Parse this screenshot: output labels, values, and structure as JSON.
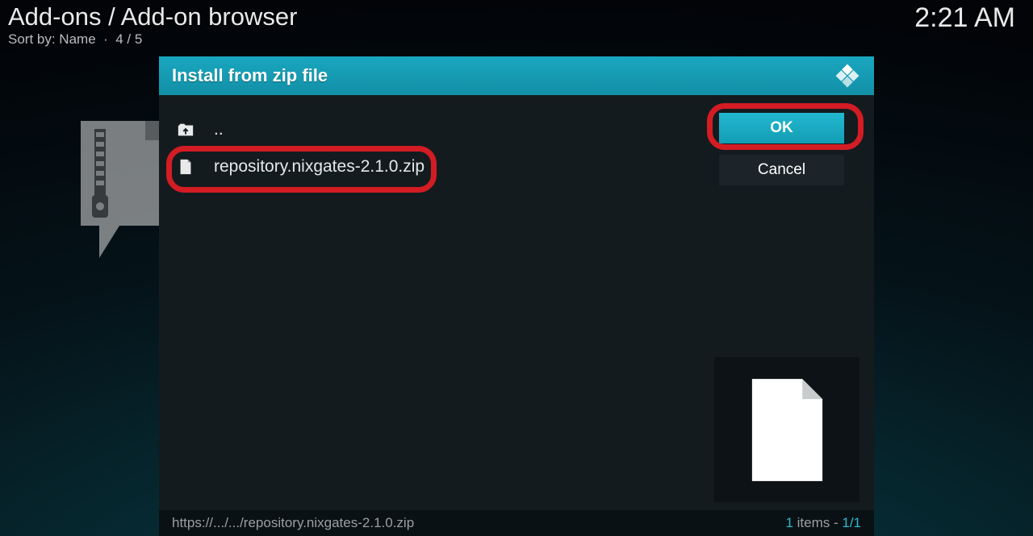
{
  "header": {
    "breadcrumb": "Add-ons / Add-on browser",
    "sort_label": "Sort by: Name",
    "position": "4 / 5"
  },
  "clock": "2:21 AM",
  "dialog": {
    "title": "Install from zip file",
    "parent_label": "..",
    "file_name": "repository.nixgates-2.1.0.zip",
    "ok_label": "OK",
    "cancel_label": "Cancel",
    "footer_path": "https://.../.../repository.nixgates-2.1.0.zip",
    "footer_count_prefix": "1",
    "footer_count_word": " items - ",
    "footer_count_page": "1/1"
  }
}
